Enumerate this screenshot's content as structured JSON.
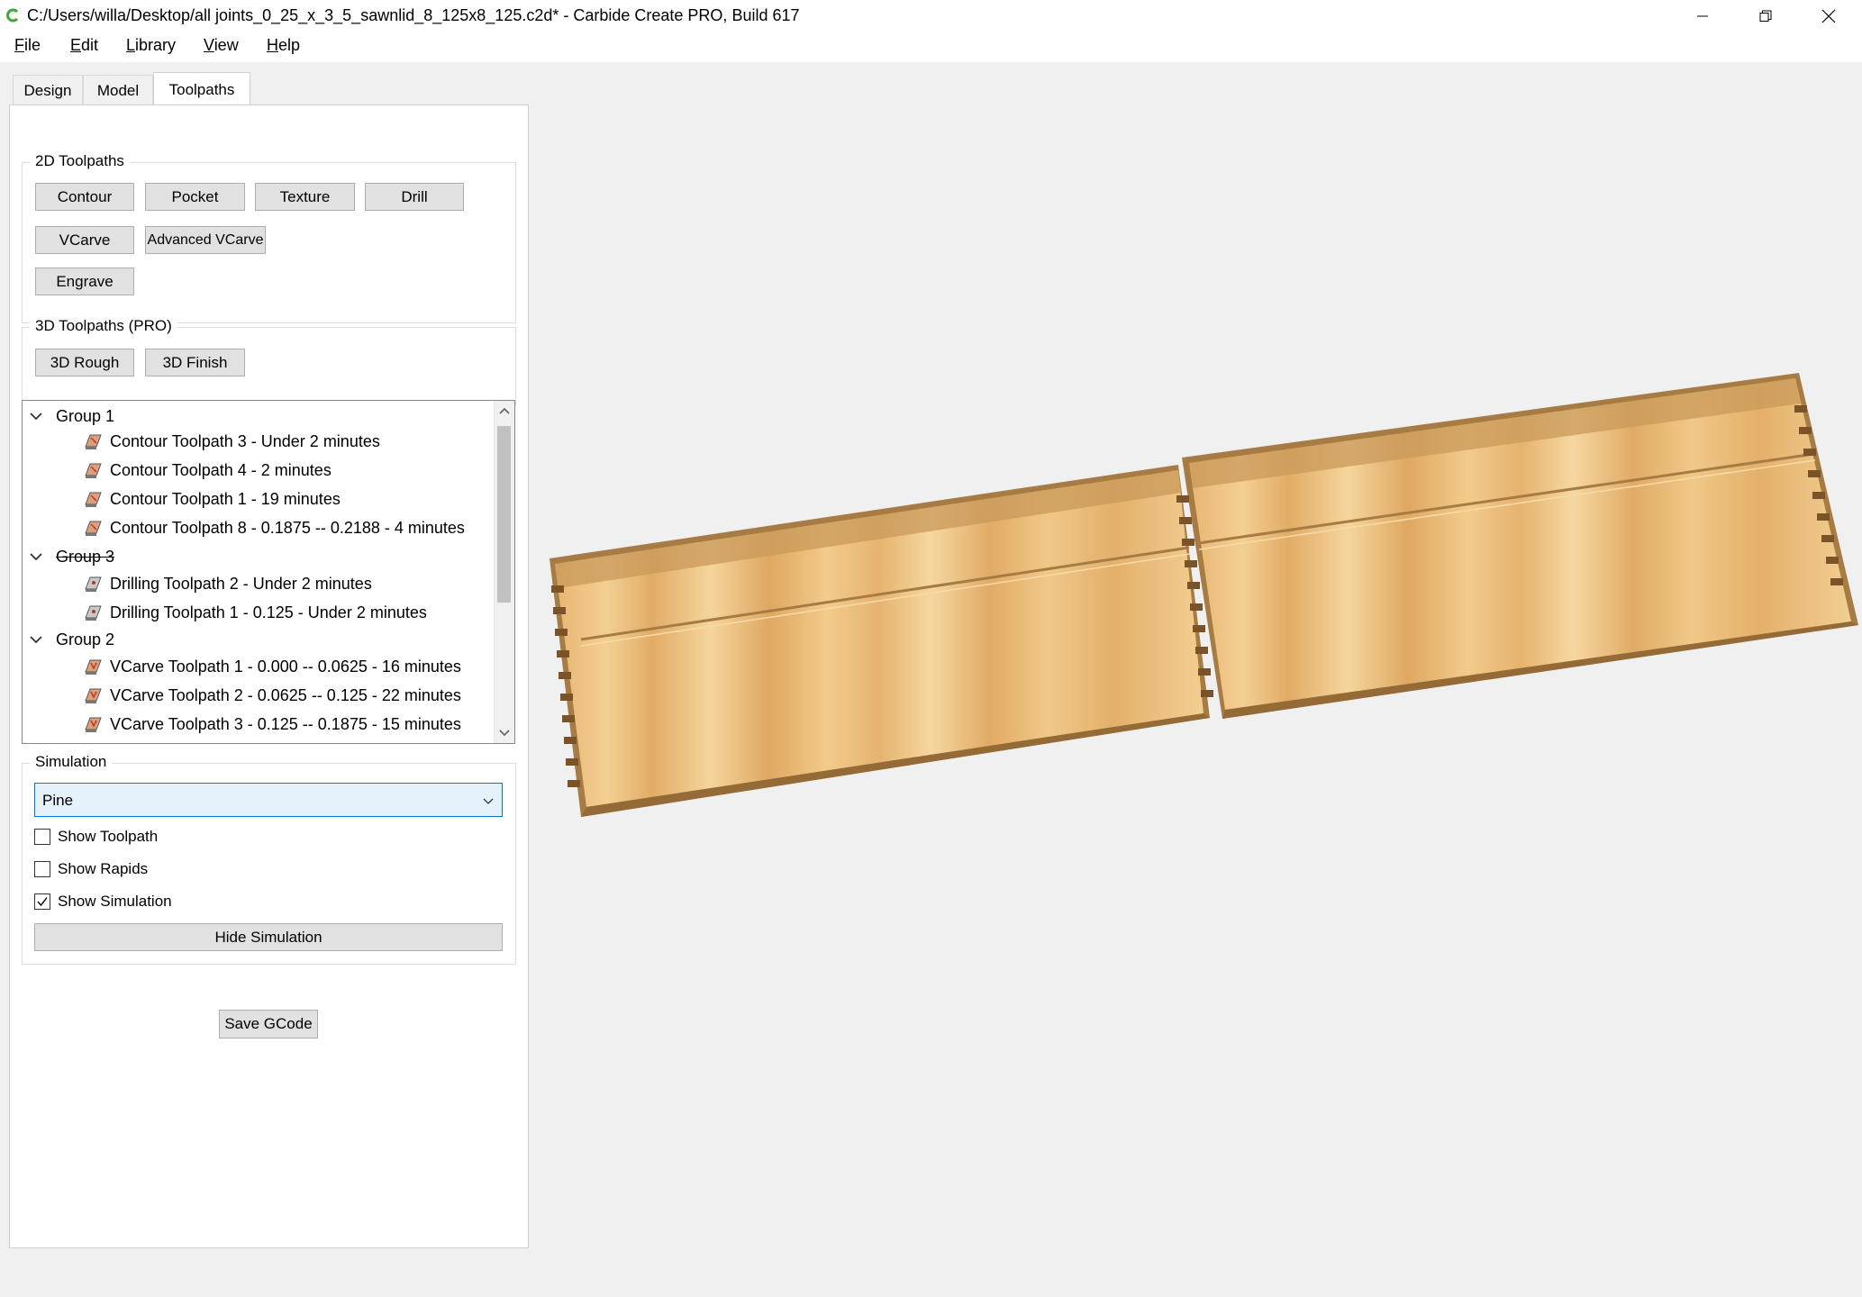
{
  "window": {
    "title": "C:/Users/willa/Desktop/all joints_0_25_x_3_5_sawnlid_8_125x8_125.c2d* - Carbide Create PRO, Build 617",
    "controls": [
      "minimize-icon",
      "restore-icon",
      "close-icon"
    ]
  },
  "menu": [
    "File",
    "Edit",
    "Library",
    "View",
    "Help"
  ],
  "tabs": [
    "Design",
    "Model",
    "Toolpaths"
  ],
  "active_tab": "Toolpaths",
  "toolpaths_2d": {
    "title": "2D Toolpaths",
    "buttons": [
      "Contour",
      "Pocket",
      "Texture",
      "Drill",
      "VCarve",
      "Advanced VCarve",
      "Engrave"
    ]
  },
  "toolpaths_3d": {
    "title": "3D Toolpaths (PRO)",
    "buttons": [
      "3D Rough",
      "3D Finish"
    ]
  },
  "tree": {
    "groups": [
      {
        "name": "Group 1",
        "struck": false,
        "items": [
          "Contour Toolpath 3 - Under 2 minutes",
          "Contour Toolpath 4 - 2 minutes",
          "Contour Toolpath 1 - 19 minutes",
          "Contour Toolpath 8 - 0.1875 -- 0.2188 - 4 minutes"
        ]
      },
      {
        "name": "Group 3",
        "struck": true,
        "items": [
          "Drilling Toolpath 2 - Under 2 minutes",
          "Drilling Toolpath 1 - 0.125 - Under 2 minutes"
        ]
      },
      {
        "name": "Group 2",
        "struck": false,
        "items": [
          "VCarve Toolpath 1 - 0.000 -- 0.0625 - 16 minutes",
          "VCarve Toolpath 2 - 0.0625 -- 0.125 - 22 minutes",
          "VCarve Toolpath 3 - 0.125 -- 0.1875 - 15 minutes"
        ]
      }
    ]
  },
  "simulation": {
    "title": "Simulation",
    "material": "Pine",
    "show_toolpath_label": "Show Toolpath",
    "show_toolpath": false,
    "show_rapids_label": "Show Rapids",
    "show_rapids": false,
    "show_simulation_label": "Show Simulation",
    "show_simulation": true,
    "hide_button": "Hide Simulation"
  },
  "save_gcode": "Save GCode",
  "colors": {
    "wood_light": "#f0c57e",
    "wood_dark": "#b8884a",
    "edge": "#a67c44",
    "accent_blue": "#0078d7",
    "select_bg": "#e5f1fb",
    "app_icon_green": "#3aa935"
  }
}
